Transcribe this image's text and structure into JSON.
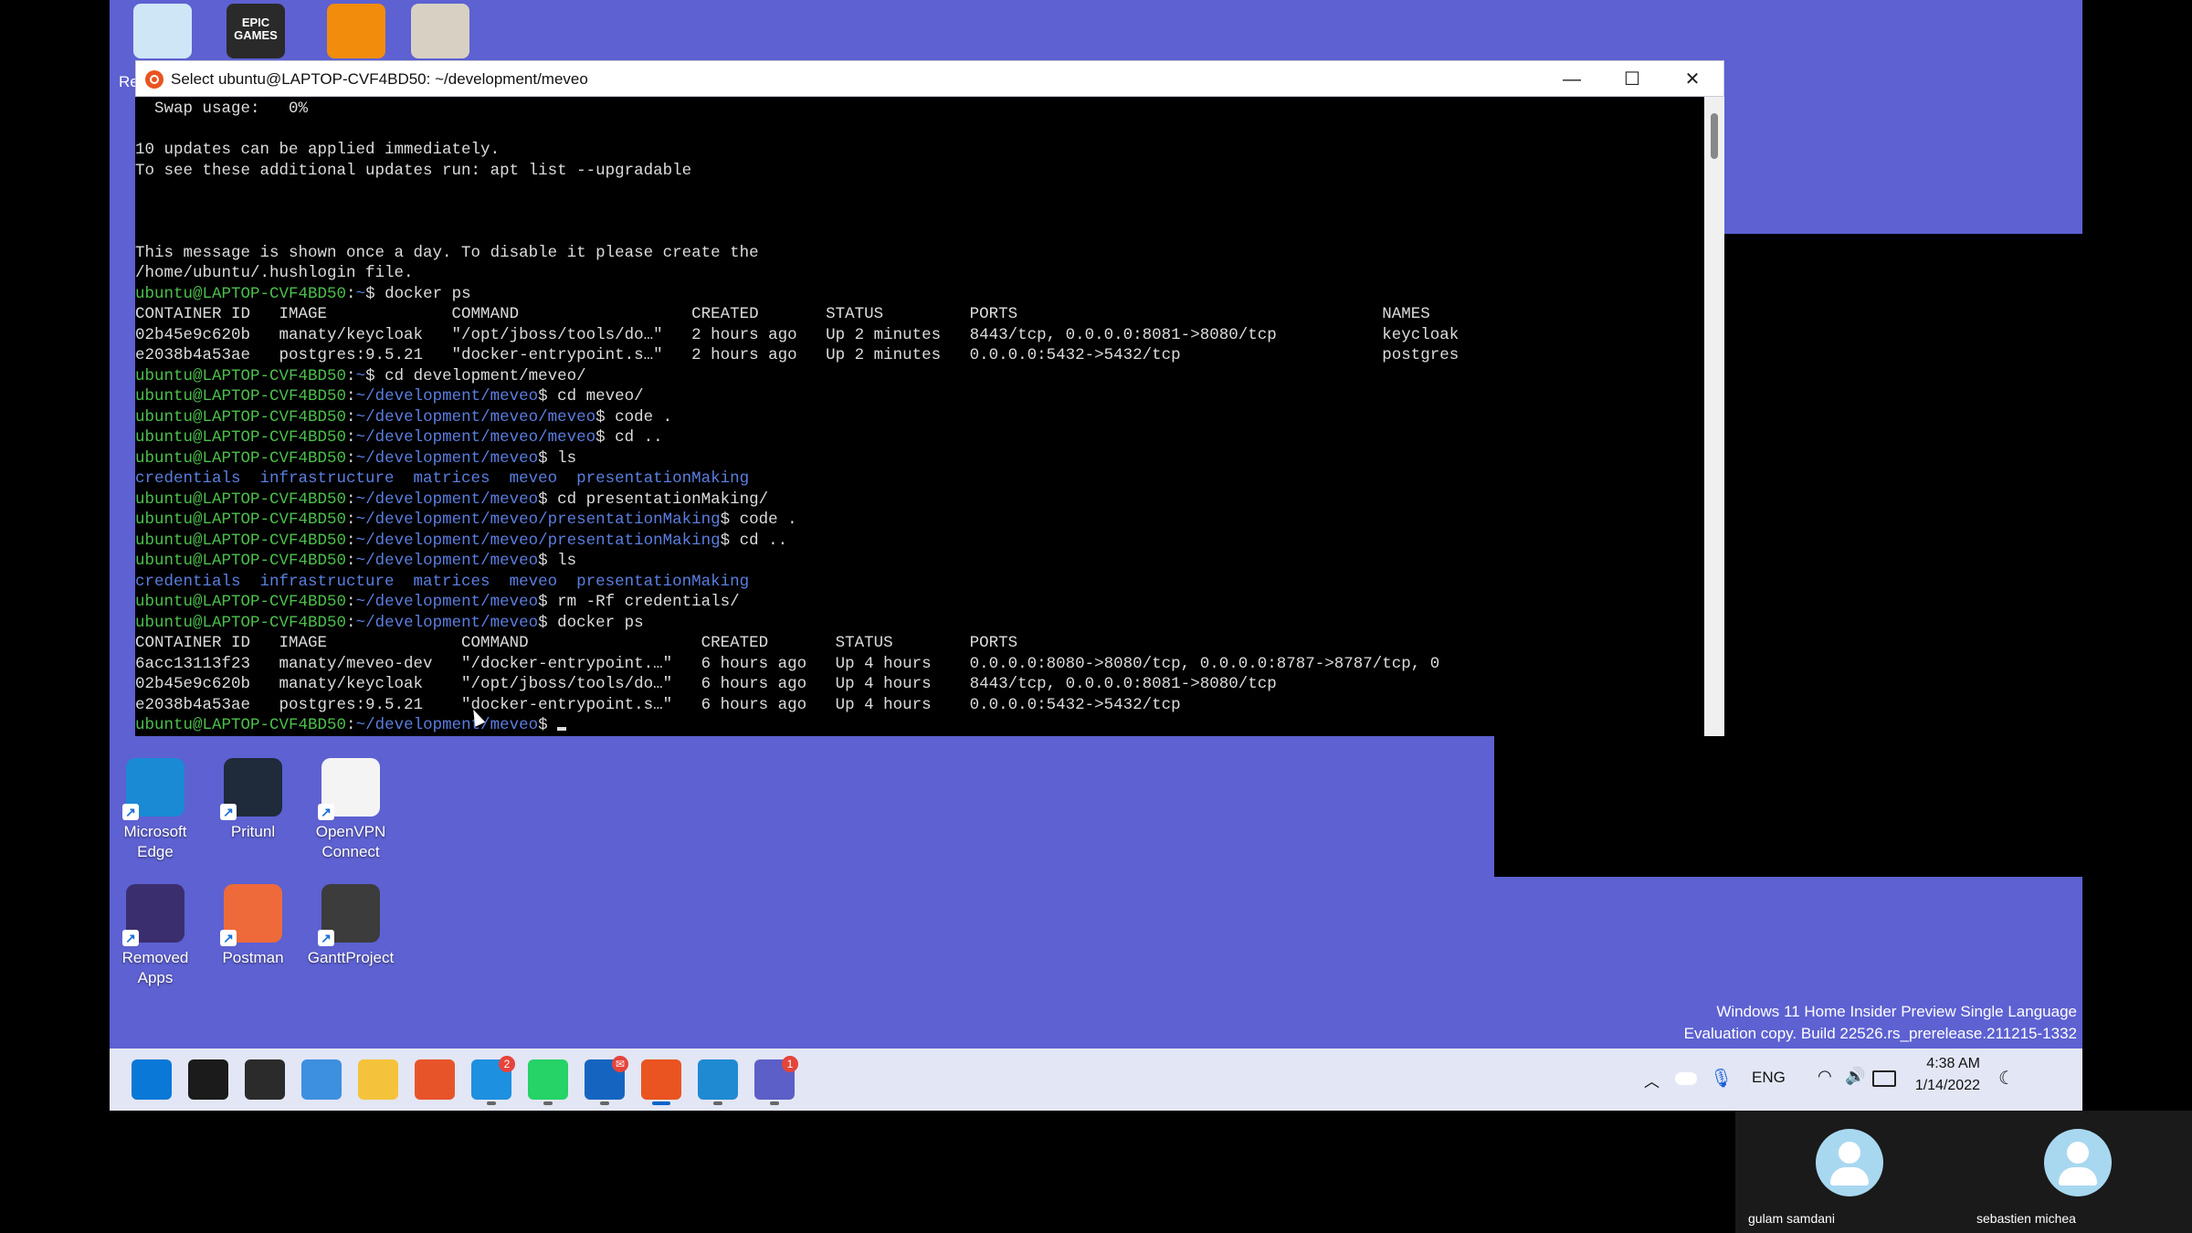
{
  "window": {
    "title": "Select ubuntu@LAPTOP-CVF4BD50: ~/development/meveo",
    "minimize_glyph": "—",
    "maximize_glyph": "☐",
    "close_glyph": "✕"
  },
  "terminal": {
    "lines": [
      [
        [
          "w",
          "  Swap usage:   0%"
        ]
      ],
      [
        [
          "w",
          ""
        ]
      ],
      [
        [
          "w",
          "10 updates can be applied immediately."
        ]
      ],
      [
        [
          "w",
          "To see these additional updates run: apt list --upgradable"
        ]
      ],
      [
        [
          "w",
          ""
        ]
      ],
      [
        [
          "w",
          ""
        ]
      ],
      [
        [
          "w",
          ""
        ]
      ],
      [
        [
          "w",
          "This message is shown once a day. To disable it please create the"
        ]
      ],
      [
        [
          "w",
          "/home/ubuntu/.hushlogin file."
        ]
      ],
      [
        [
          "g",
          "ubuntu@LAPTOP-CVF4BD50"
        ],
        [
          "w",
          ":"
        ],
        [
          "b",
          "~"
        ],
        [
          "w",
          "$ docker ps"
        ]
      ],
      [
        [
          "w",
          "CONTAINER ID   IMAGE             COMMAND                  CREATED       STATUS         PORTS                                      NAMES"
        ]
      ],
      [
        [
          "w",
          "02b45e9c620b   manaty/keycloak   \"/opt/jboss/tools/do…\"   2 hours ago   Up 2 minutes   8443/tcp, 0.0.0.0:8081->8080/tcp           keycloak"
        ]
      ],
      [
        [
          "w",
          "e2038b4a53ae   postgres:9.5.21   \"docker-entrypoint.s…\"   2 hours ago   Up 2 minutes   0.0.0.0:5432->5432/tcp                     postgres"
        ]
      ],
      [
        [
          "g",
          "ubuntu@LAPTOP-CVF4BD50"
        ],
        [
          "w",
          ":"
        ],
        [
          "b",
          "~"
        ],
        [
          "w",
          "$ cd development/meveo/"
        ]
      ],
      [
        [
          "g",
          "ubuntu@LAPTOP-CVF4BD50"
        ],
        [
          "w",
          ":"
        ],
        [
          "b",
          "~/development/meveo"
        ],
        [
          "w",
          "$ cd meveo/"
        ]
      ],
      [
        [
          "g",
          "ubuntu@LAPTOP-CVF4BD50"
        ],
        [
          "w",
          ":"
        ],
        [
          "b",
          "~/development/meveo/meveo"
        ],
        [
          "w",
          "$ code ."
        ]
      ],
      [
        [
          "g",
          "ubuntu@LAPTOP-CVF4BD50"
        ],
        [
          "w",
          ":"
        ],
        [
          "b",
          "~/development/meveo/meveo"
        ],
        [
          "w",
          "$ cd .."
        ]
      ],
      [
        [
          "g",
          "ubuntu@LAPTOP-CVF4BD50"
        ],
        [
          "w",
          ":"
        ],
        [
          "b",
          "~/development/meveo"
        ],
        [
          "w",
          "$ ls"
        ]
      ],
      [
        [
          "b",
          "credentials  infrastructure  matrices  meveo  presentationMaking"
        ]
      ],
      [
        [
          "g",
          "ubuntu@LAPTOP-CVF4BD50"
        ],
        [
          "w",
          ":"
        ],
        [
          "b",
          "~/development/meveo"
        ],
        [
          "w",
          "$ cd presentationMaking/"
        ]
      ],
      [
        [
          "g",
          "ubuntu@LAPTOP-CVF4BD50"
        ],
        [
          "w",
          ":"
        ],
        [
          "b",
          "~/development/meveo/presentationMaking"
        ],
        [
          "w",
          "$ code ."
        ]
      ],
      [
        [
          "g",
          "ubuntu@LAPTOP-CVF4BD50"
        ],
        [
          "w",
          ":"
        ],
        [
          "b",
          "~/development/meveo/presentationMaking"
        ],
        [
          "w",
          "$ cd .."
        ]
      ],
      [
        [
          "g",
          "ubuntu@LAPTOP-CVF4BD50"
        ],
        [
          "w",
          ":"
        ],
        [
          "b",
          "~/development/meveo"
        ],
        [
          "w",
          "$ ls"
        ]
      ],
      [
        [
          "b",
          "credentials  infrastructure  matrices  meveo  presentationMaking"
        ]
      ],
      [
        [
          "g",
          "ubuntu@LAPTOP-CVF4BD50"
        ],
        [
          "w",
          ":"
        ],
        [
          "b",
          "~/development/meveo"
        ],
        [
          "w",
          "$ rm -Rf credentials/"
        ]
      ],
      [
        [
          "g",
          "ubuntu@LAPTOP-CVF4BD50"
        ],
        [
          "w",
          ":"
        ],
        [
          "b",
          "~/development/meveo"
        ],
        [
          "w",
          "$ docker ps"
        ]
      ],
      [
        [
          "w",
          "CONTAINER ID   IMAGE              COMMAND                  CREATED       STATUS        PORTS"
        ]
      ],
      [
        [
          "w",
          "6acc13113f23   manaty/meveo-dev   \"/docker-entrypoint.…\"   6 hours ago   Up 4 hours    0.0.0.0:8080->8080/tcp, 0.0.0.0:8787->8787/tcp, 0"
        ]
      ],
      [
        [
          "w",
          "02b45e9c620b   manaty/keycloak    \"/opt/jboss/tools/do…\"   6 hours ago   Up 4 hours    8443/tcp, 0.0.0.0:8081->8080/tcp"
        ]
      ],
      [
        [
          "w",
          "e2038b4a53ae   postgres:9.5.21    \"docker-entrypoint.s…\"   6 hours ago   Up 4 hours    0.0.0.0:5432->5432/tcp"
        ]
      ],
      [
        [
          "g",
          "ubuntu@LAPTOP-CVF4BD50"
        ],
        [
          "w",
          ":"
        ],
        [
          "b",
          "~/development/meveo"
        ],
        [
          "w",
          "$ "
        ]
      ]
    ]
  },
  "desktop": {
    "icons": [
      {
        "label": "Microsoft\nEdge",
        "icon": "edge-icon",
        "color": "#1a8ad4"
      },
      {
        "label": "Pritunl",
        "icon": "pritunl-icon",
        "color": "#1f2a3a"
      },
      {
        "label": "OpenVPN\nConnect",
        "icon": "openvpn-icon",
        "color": "#f4f4f4"
      },
      {
        "label": "Removed\nApps",
        "icon": "removed-apps-icon",
        "color": "#3a2e6e"
      },
      {
        "label": "Postman",
        "icon": "postman-icon",
        "color": "#ef6a3a"
      },
      {
        "label": "GanttProject",
        "icon": "ganttproject-icon",
        "color": "#3c3c3c"
      }
    ],
    "top_icons": [
      {
        "icon": "recycle-bin-icon",
        "color": "#cfe6f7"
      },
      {
        "icon": "epic-games-icon",
        "color": "#2a2a2a",
        "text": "EPIC GAMES"
      },
      {
        "icon": "vlc-icon",
        "color": "#f28c0c"
      },
      {
        "icon": "gimp-icon",
        "color": "#d8d1c3"
      }
    ],
    "partial_label_re": "Re",
    "watermark_line1": "Windows 11 Home Insider Preview Single Language",
    "watermark_line2": "Evaluation copy. Build 22526.rs_prerelease.211215-1332"
  },
  "taskbar": {
    "icons": [
      {
        "icon": "start-icon",
        "color": "#0a78d7"
      },
      {
        "icon": "search-icon",
        "color": "#1b1b1b"
      },
      {
        "icon": "task-view-icon",
        "color": "#2b2b2b"
      },
      {
        "icon": "widgets-icon",
        "color": "#3d8fe0"
      },
      {
        "icon": "file-explorer-icon",
        "color": "#f5c33b"
      },
      {
        "icon": "firefox-icon",
        "color": "#e8542a"
      },
      {
        "icon": "skype-icon",
        "color": "#1e90e0",
        "badge": "2"
      },
      {
        "icon": "whatsapp-icon",
        "color": "#25d366"
      },
      {
        "icon": "outlook-icon",
        "color": "#1565c0",
        "badge": "✉"
      },
      {
        "icon": "ubuntu-terminal-icon",
        "color": "#e95420"
      },
      {
        "icon": "vscode-icon",
        "color": "#1f8ad2"
      },
      {
        "icon": "teams-icon",
        "color": "#5b5fc7",
        "badge": "1"
      }
    ],
    "language": "ENG",
    "time": "4:38 AM",
    "date": "1/14/2022"
  },
  "participants": [
    {
      "name": "gulam samdani"
    },
    {
      "name": "sebastien michea"
    }
  ]
}
